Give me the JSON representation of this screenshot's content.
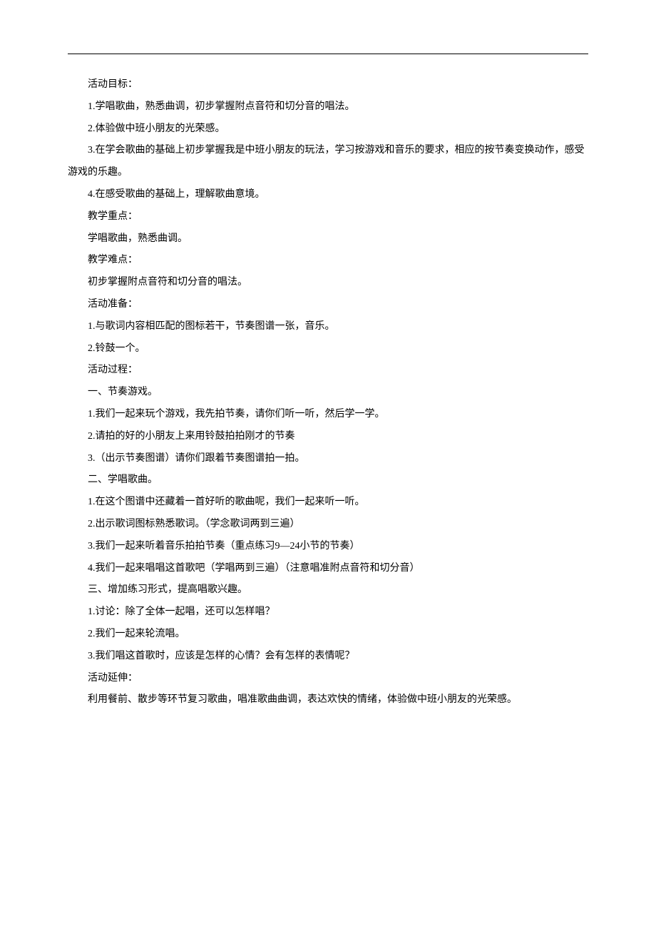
{
  "doc": {
    "sections": {
      "goal_heading": "活动目标：",
      "goals": [
        "1.学唱歌曲，熟悉曲调，初步掌握附点音符和切分音的唱法。",
        "2.体验做中班小朋友的光荣感。",
        "3.在学会歌曲的基础上初步掌握我是中班小朋友的玩法，学习按游戏和音乐的要求，相应的按节奏变换动作，感受游戏的乐趣。",
        "4.在感受歌曲的基础上，理解歌曲意境。"
      ],
      "keypoint_heading": "教学重点：",
      "keypoint": "学唱歌曲，熟悉曲调。",
      "difficulty_heading": "教学难点：",
      "difficulty": "初步掌握附点音符和切分音的唱法。",
      "prep_heading": "活动准备：",
      "preps": [
        "1.与歌词内容相匹配的图标若干，节奏图谱一张，音乐。",
        "2.铃鼓一个。"
      ],
      "process_heading": "活动过程：",
      "section1_heading": "一、节奏游戏。",
      "section1_items": [
        "1.我们一起来玩个游戏，我先拍节奏，请你们听一听，然后学一学。",
        "2.请拍的好的小朋友上来用铃鼓拍拍刚才的节奏",
        "3.（出示节奏图谱）请你们跟着节奏图谱拍一拍。"
      ],
      "section2_heading": "二、学唱歌曲。",
      "section2_items": [
        "1.在这个图谱中还藏着一首好听的歌曲呢，我们一起来听一听。",
        "2.出示歌词图标熟悉歌词。（学念歌词两到三遍）",
        "3.我们一起来听着音乐拍拍节奏（重点练习9—24小节的节奏）",
        "4.我们一起来唱唱这首歌吧（学唱两到三遍）（注意唱准附点音符和切分音）"
      ],
      "section3_heading": "三、增加练习形式，提高唱歌兴趣。",
      "section3_items": [
        "1.讨论：除了全体一起唱，还可以怎样唱？",
        "2.我们一起来轮流唱。",
        "3.我们唱这首歌时，应该是怎样的心情？会有怎样的表情呢？"
      ],
      "extension_heading": "活动延伸：",
      "extension": "利用餐前、散步等环节复习歌曲，唱准歌曲曲调，表达欢快的情绪，体验做中班小朋友的光荣感。"
    }
  }
}
